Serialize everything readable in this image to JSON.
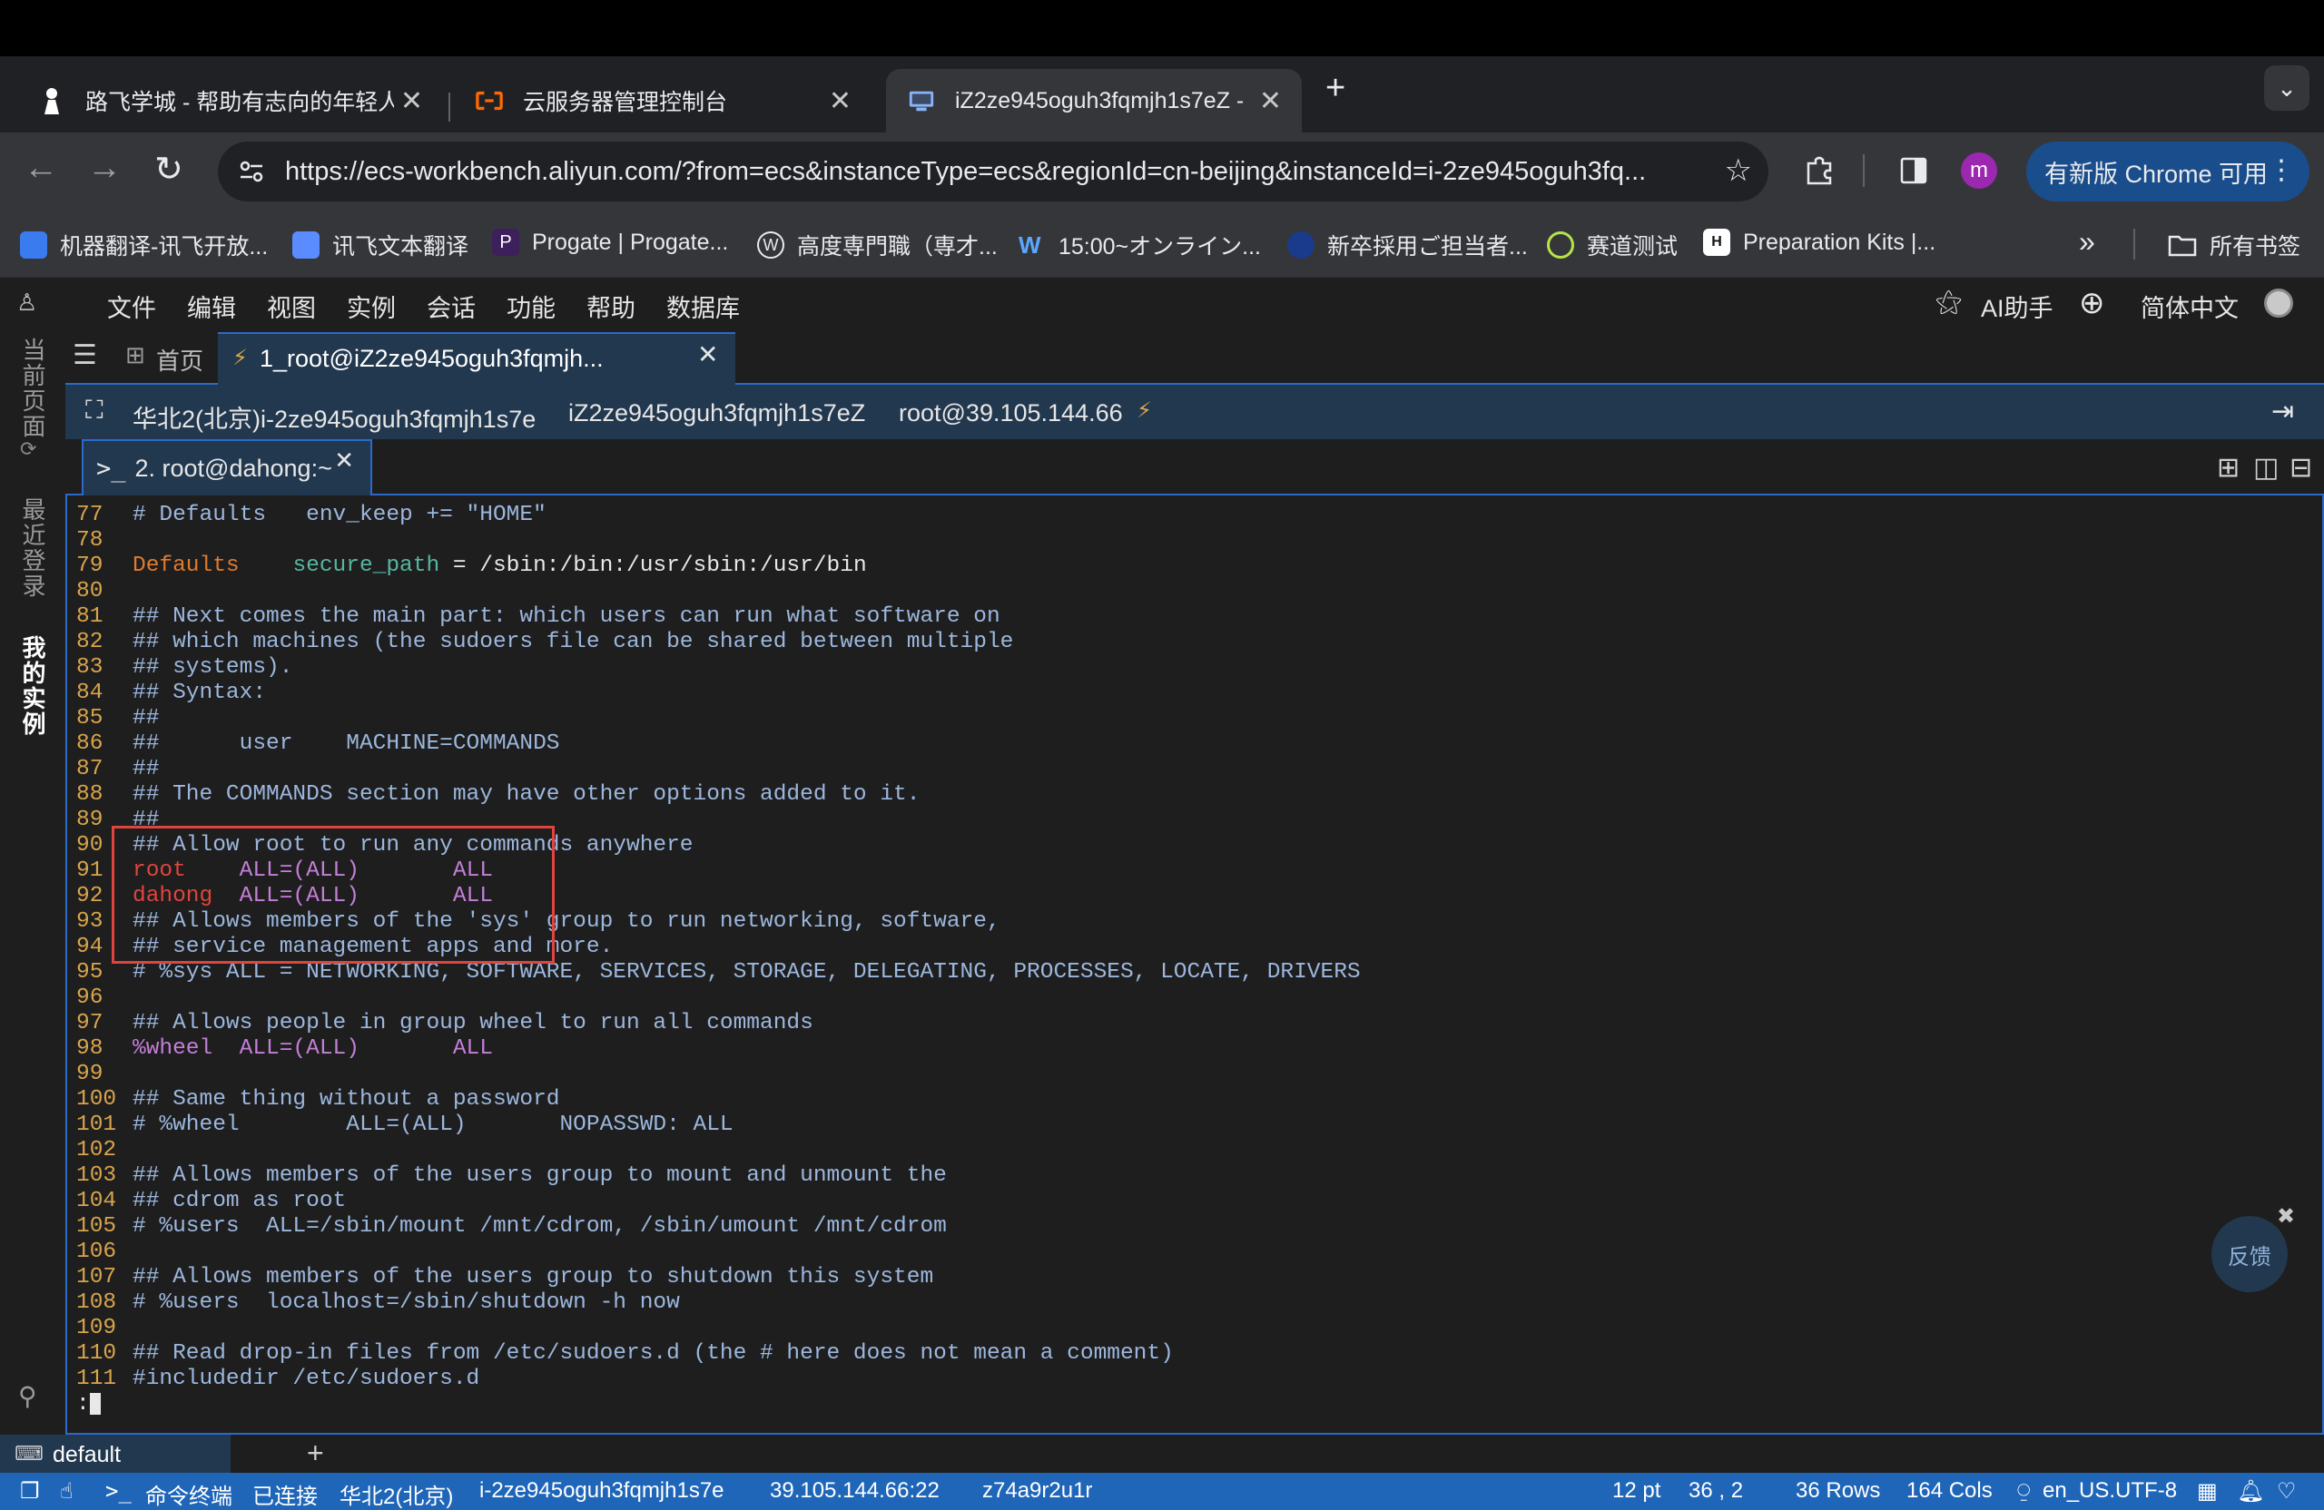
{
  "browser": {
    "tabs": [
      {
        "title": "路飞学城 - 帮助有志向的年轻人",
        "icon": "person-icon"
      },
      {
        "title": "云服务器管理控制台",
        "icon": "aliyun-icon"
      },
      {
        "title": "iZ2ze945oguh3fqmjh1s7eZ -",
        "icon": "terminal-monitor-icon"
      }
    ],
    "url": "https://ecs-workbench.aliyun.com/?from=ecs&instanceType=ecs&regionId=cn-beijing&instanceId=i-2ze945oguh3fq...",
    "profile_letter": "m",
    "update_label": "有新版 Chrome 可用",
    "bookmarks": [
      "机器翻译-讯飞开放...",
      "讯飞文本翻译",
      "Progate | Progate...",
      "高度専門職（専才...",
      "15:00~オンライン...",
      "新卒採用ご担当者...",
      "赛道测试",
      "Preparation Kits |..."
    ],
    "bookmarks_folder": "所有书签"
  },
  "app": {
    "menu": [
      "文件",
      "编辑",
      "视图",
      "实例",
      "会话",
      "功能",
      "帮助",
      "数据库"
    ],
    "ai_assistant": "AI助手",
    "language": "简体中文",
    "left_rail": [
      "当前页面",
      "最近登录",
      "我的实例"
    ],
    "home_tab": "首页",
    "session_tab": "1_root@iZ2ze945oguh3fqmjh...",
    "session_info": {
      "region_instance": "华北2(北京)i-2ze945oguh3fqmjh1s7e",
      "hostname": "iZ2ze945oguh3fqmjh1s7eZ",
      "login": "root@39.105.144.66"
    },
    "terminal_tab": "2. root@dahong:~",
    "feedback": "反馈",
    "bottom_tab": "default"
  },
  "terminal": {
    "lines": [
      {
        "n": "77",
        "parts": [
          {
            "c": "cmt",
            "t": "# Defaults   env_keep += \"HOME\""
          }
        ]
      },
      {
        "n": "78",
        "parts": []
      },
      {
        "n": "79",
        "parts": [
          {
            "c": "kw",
            "t": "Defaults"
          },
          {
            "c": "wht",
            "t": "    "
          },
          {
            "c": "grn",
            "t": "secure_path"
          },
          {
            "c": "wht",
            "t": " = /sbin:/bin:/usr/sbin:/usr/bin"
          }
        ]
      },
      {
        "n": "80",
        "parts": []
      },
      {
        "n": "81",
        "parts": [
          {
            "c": "cmt",
            "t": "## Next comes the main part: which users can run what software on"
          }
        ]
      },
      {
        "n": "82",
        "parts": [
          {
            "c": "cmt",
            "t": "## which machines (the sudoers file can be shared between multiple"
          }
        ]
      },
      {
        "n": "83",
        "parts": [
          {
            "c": "cmt",
            "t": "## systems)."
          }
        ]
      },
      {
        "n": "84",
        "parts": [
          {
            "c": "cmt",
            "t": "## Syntax:"
          }
        ]
      },
      {
        "n": "85",
        "parts": [
          {
            "c": "cmt",
            "t": "##"
          }
        ]
      },
      {
        "n": "86",
        "parts": [
          {
            "c": "cmt",
            "t": "##      user    MACHINE=COMMANDS"
          }
        ]
      },
      {
        "n": "87",
        "parts": [
          {
            "c": "cmt",
            "t": "##"
          }
        ]
      },
      {
        "n": "88",
        "parts": [
          {
            "c": "cmt",
            "t": "## The COMMANDS section may have other options added to it."
          }
        ]
      },
      {
        "n": "89",
        "parts": [
          {
            "c": "cmt",
            "t": "##"
          }
        ]
      },
      {
        "n": "90",
        "parts": [
          {
            "c": "cmt",
            "t": "## Allow root to run any commands anywhere"
          }
        ]
      },
      {
        "n": "91",
        "parts": [
          {
            "c": "red",
            "t": "root"
          },
          {
            "c": "vio",
            "t": "    ALL=(ALL)       ALL"
          }
        ]
      },
      {
        "n": "92",
        "parts": [
          {
            "c": "red",
            "t": "dahong"
          },
          {
            "c": "vio",
            "t": "  ALL=(ALL)       ALL"
          }
        ]
      },
      {
        "n": "93",
        "parts": [
          {
            "c": "cmt",
            "t": "## Allows members of the 'sys' group to run networking, software,"
          }
        ]
      },
      {
        "n": "94",
        "parts": [
          {
            "c": "cmt",
            "t": "## service management apps and more."
          }
        ]
      },
      {
        "n": "95",
        "parts": [
          {
            "c": "cmt",
            "t": "# %sys ALL = NETWORKING, SOFTWARE, SERVICES, STORAGE, DELEGATING, PROCESSES, LOCATE, DRIVERS"
          }
        ]
      },
      {
        "n": "96",
        "parts": []
      },
      {
        "n": "97",
        "parts": [
          {
            "c": "cmt",
            "t": "## Allows people in group wheel to run all commands"
          }
        ]
      },
      {
        "n": "98",
        "parts": [
          {
            "c": "vio",
            "t": "%wheel  ALL=(ALL)       ALL"
          }
        ]
      },
      {
        "n": "99",
        "parts": []
      },
      {
        "n": "100",
        "parts": [
          {
            "c": "cmt",
            "t": "## Same thing without a password"
          }
        ]
      },
      {
        "n": "101",
        "parts": [
          {
            "c": "cmt",
            "t": "# %wheel        ALL=(ALL)       NOPASSWD: ALL"
          }
        ]
      },
      {
        "n": "102",
        "parts": []
      },
      {
        "n": "103",
        "parts": [
          {
            "c": "cmt",
            "t": "## Allows members of the users group to mount and unmount the"
          }
        ]
      },
      {
        "n": "104",
        "parts": [
          {
            "c": "cmt",
            "t": "## cdrom as root"
          }
        ]
      },
      {
        "n": "105",
        "parts": [
          {
            "c": "cmt",
            "t": "# %users  ALL=/sbin/mount /mnt/cdrom, /sbin/umount /mnt/cdrom"
          }
        ]
      },
      {
        "n": "106",
        "parts": []
      },
      {
        "n": "107",
        "parts": [
          {
            "c": "cmt",
            "t": "## Allows members of the users group to shutdown this system"
          }
        ]
      },
      {
        "n": "108",
        "parts": [
          {
            "c": "cmt",
            "t": "# %users  localhost=/sbin/shutdown -h now"
          }
        ]
      },
      {
        "n": "109",
        "parts": []
      },
      {
        "n": "110",
        "parts": [
          {
            "c": "cmt",
            "t": "## Read drop-in files from /etc/sudoers.d (the # here does not mean a comment)"
          }
        ]
      },
      {
        "n": "111",
        "parts": [
          {
            "c": "cmt",
            "t": "#includedir /etc/sudoers.d"
          }
        ]
      }
    ],
    "prompt": ":"
  },
  "statusbar": {
    "terminal_label": "命令终端",
    "connection": "已连接",
    "region": "华北2(北京)",
    "instance_id": "i-2ze945oguh3fqmjh1s7e",
    "address": "39.105.144.66:22",
    "session_code": "z74a9r2u1r",
    "font_size": "12 pt",
    "cursor": "36 , 2",
    "rows": "36 Rows",
    "cols": "164 Cols",
    "locale": "en_US.UTF-8"
  },
  "colors": {
    "accent": "#2a6acb",
    "statusbar": "#1f66b9",
    "highlight_box": "#e0443e"
  }
}
